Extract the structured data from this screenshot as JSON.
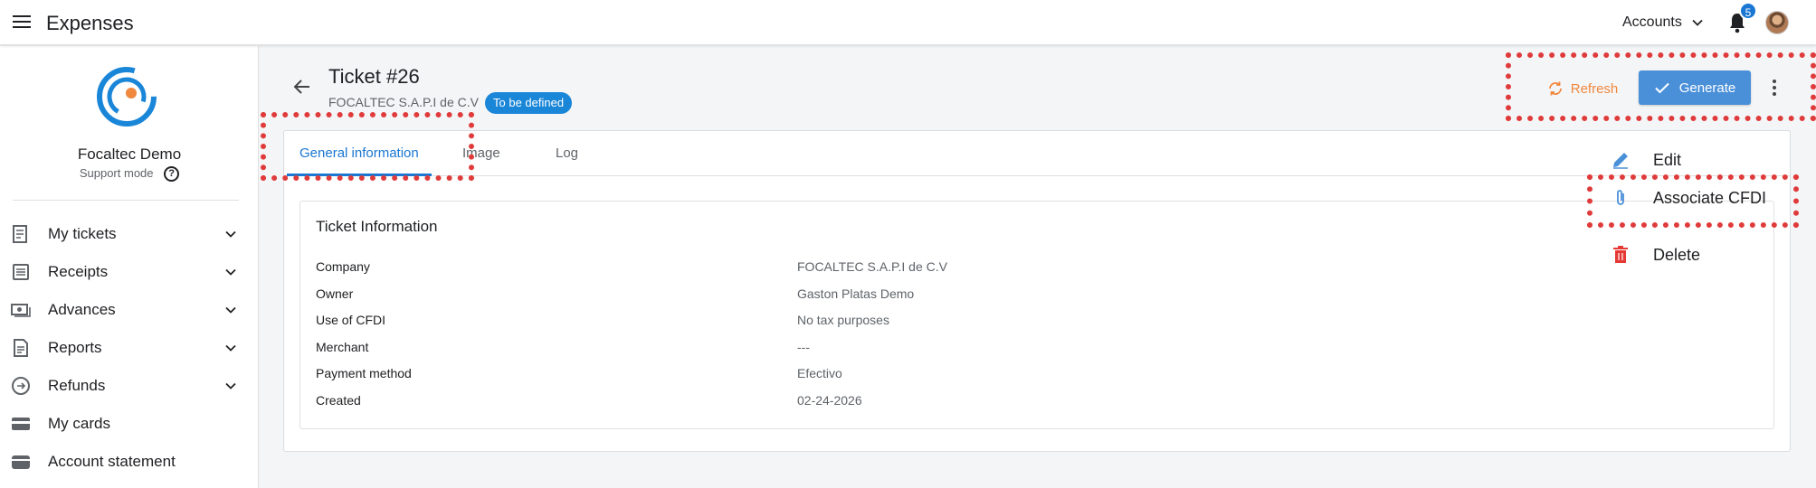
{
  "topbar": {
    "app_title": "Expenses",
    "accounts_label": "Accounts",
    "notification_count": "5"
  },
  "sidebar": {
    "org_name": "Focaltec Demo",
    "support_label": "Support mode",
    "help_glyph": "?",
    "items": [
      {
        "label": "My tickets",
        "icon": "receipt-icon",
        "expandable": true
      },
      {
        "label": "Receipts",
        "icon": "list-icon",
        "expandable": true
      },
      {
        "label": "Advances",
        "icon": "cash-icon",
        "expandable": true
      },
      {
        "label": "Reports",
        "icon": "report-icon",
        "expandable": true
      },
      {
        "label": "Refunds",
        "icon": "refund-icon",
        "expandable": true
      },
      {
        "label": "My cards",
        "icon": "card-icon",
        "expandable": false
      },
      {
        "label": "Account statement",
        "icon": "wallet-icon",
        "expandable": false
      }
    ]
  },
  "ticket": {
    "title": "Ticket #26",
    "company": "FOCALTEC S.A.P.I de C.V",
    "status": "To be defined"
  },
  "actions": {
    "refresh_label": "Refresh",
    "generate_label": "Generate"
  },
  "tabs": [
    {
      "label": "General information",
      "active": true
    },
    {
      "label": "Image",
      "active": false
    },
    {
      "label": "Log",
      "active": false
    }
  ],
  "info": {
    "title": "Ticket Information",
    "rows": [
      {
        "key": "Company",
        "value": "FOCALTEC S.A.P.I de C.V"
      },
      {
        "key": "Owner",
        "value": "Gaston Platas Demo"
      },
      {
        "key": "Use of CFDI",
        "value": "No tax purposes"
      },
      {
        "key": "Merchant",
        "value": "---"
      },
      {
        "key": "Payment method",
        "value": "Efectivo"
      },
      {
        "key": "Created",
        "value": "02-24-2026"
      }
    ]
  },
  "menu": {
    "items": [
      {
        "label": "Edit",
        "icon": "pencil-icon"
      },
      {
        "label": "Associate CFDI",
        "icon": "paperclip-icon"
      },
      {
        "label": "Delete",
        "icon": "trash-icon"
      }
    ]
  },
  "colors": {
    "primary": "#1976d2",
    "generate_button": "#4a90d9",
    "refresh": "#f0883e",
    "delete": "#e53935",
    "highlight": "#e03b3b"
  }
}
